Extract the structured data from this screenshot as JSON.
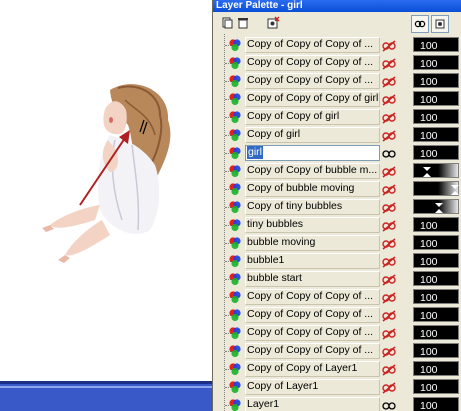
{
  "window": {
    "title": "Layer Palette - girl"
  },
  "toolbar": {
    "buttons": [
      {
        "name": "new-layer-icon"
      },
      {
        "name": "delete-layer-icon"
      },
      {
        "name": "layer-properties-icon"
      }
    ],
    "tabs": [
      {
        "name": "visibility-tab-icon"
      },
      {
        "name": "mask-tab-icon"
      }
    ]
  },
  "layers": [
    {
      "label": "Copy of Copy of Copy of ...",
      "visible": true,
      "opacity": "100"
    },
    {
      "label": "Copy of Copy of Copy of ...",
      "visible": true,
      "opacity": "100"
    },
    {
      "label": "Copy of Copy of Copy of ...",
      "visible": true,
      "opacity": "100"
    },
    {
      "label": "Copy of Copy of Copy of girl",
      "visible": true,
      "opacity": "100"
    },
    {
      "label": "Copy of Copy of girl",
      "visible": true,
      "opacity": "100"
    },
    {
      "label": "Copy of girl",
      "visible": true,
      "opacity": "100"
    },
    {
      "label": "girl",
      "visible": false,
      "opacity": "100",
      "selected": true
    },
    {
      "label": "Copy of Copy of bubble m...",
      "visible": true,
      "opacity": "",
      "slider": "left"
    },
    {
      "label": "Copy of bubble moving",
      "visible": true,
      "opacity": "",
      "slider": "right"
    },
    {
      "label": "Copy of tiny bubbles",
      "visible": true,
      "opacity": "",
      "slider": "mid"
    },
    {
      "label": "tiny bubbles",
      "visible": true,
      "opacity": "100"
    },
    {
      "label": "bubble moving",
      "visible": true,
      "opacity": "100"
    },
    {
      "label": "bubble1",
      "visible": true,
      "opacity": "100"
    },
    {
      "label": "bubble start",
      "visible": true,
      "opacity": "100"
    },
    {
      "label": "Copy of Copy of Copy of ...",
      "visible": true,
      "opacity": "100"
    },
    {
      "label": "Copy of Copy of Copy of ...",
      "visible": true,
      "opacity": "100"
    },
    {
      "label": "Copy of Copy of Copy of ...",
      "visible": true,
      "opacity": "100"
    },
    {
      "label": "Copy of Copy of Copy of ...",
      "visible": true,
      "opacity": "100"
    },
    {
      "label": "Copy of Copy of Layer1",
      "visible": true,
      "opacity": "100"
    },
    {
      "label": "Copy of Layer1",
      "visible": true,
      "opacity": "100"
    },
    {
      "label": "Layer1",
      "visible": false,
      "opacity": "100"
    }
  ],
  "colors": {
    "title_gradient_top": "#2a6bf0",
    "selection": "#316ac5",
    "hidden_layer_red": "#cc2222",
    "taskbar_blue": "#3a59c8"
  }
}
